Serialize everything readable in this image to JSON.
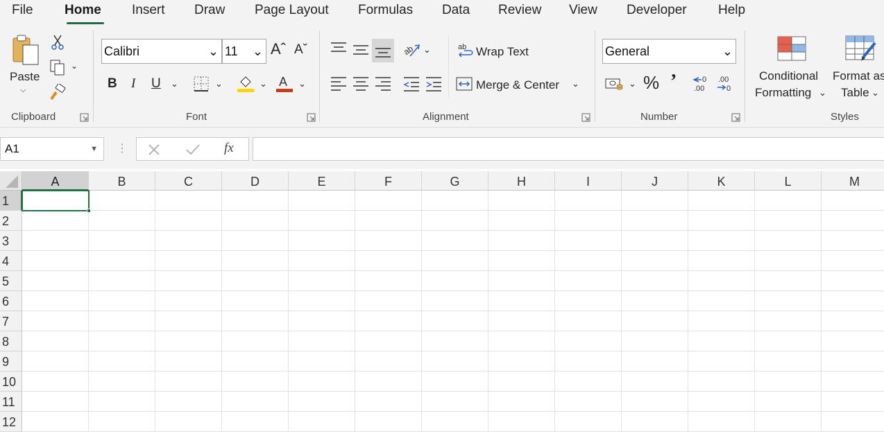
{
  "tabs": {
    "file": "File",
    "home": "Home",
    "insert": "Insert",
    "draw": "Draw",
    "page_layout": "Page Layout",
    "formulas": "Formulas",
    "data": "Data",
    "review": "Review",
    "view": "View",
    "developer": "Developer",
    "help": "Help",
    "active": "Home"
  },
  "ribbon": {
    "clipboard": {
      "label": "Clipboard",
      "paste": "Paste"
    },
    "font": {
      "label": "Font",
      "font_name": "Calibri",
      "font_size": "11",
      "bold": "B",
      "italic": "I",
      "underline": "U"
    },
    "alignment": {
      "label": "Alignment",
      "wrap_text": "Wrap Text",
      "merge_center": "Merge & Center"
    },
    "number": {
      "label": "Number",
      "format": "General",
      "percent": "%"
    },
    "styles": {
      "label": "Styles",
      "conditional_line1": "Conditional",
      "conditional_line2": "Formatting",
      "format_table_line1": "Format as",
      "format_table_line2": "Table"
    }
  },
  "formula_bar": {
    "name_box": "A1",
    "fx": "fx",
    "value": ""
  },
  "grid": {
    "columns": [
      "A",
      "B",
      "C",
      "D",
      "E",
      "F",
      "G",
      "H",
      "I",
      "J",
      "K",
      "L",
      "M"
    ],
    "rows": [
      "1",
      "2",
      "3",
      "4",
      "5",
      "6",
      "7",
      "8",
      "9",
      "10",
      "11",
      "12"
    ],
    "selected_cell": "A1"
  },
  "colors": {
    "accent": "#217346",
    "ribbon_bg": "#f3f3f3",
    "font_color": "#c43e1c",
    "highlight_color": "#ffd700"
  },
  "icons": [
    "paste-icon",
    "cut-icon",
    "copy-icon",
    "format-painter-icon",
    "font-size-increase-icon",
    "font-size-decrease-icon",
    "borders-icon",
    "fill-color-icon",
    "font-color-icon",
    "align-top-icon",
    "align-middle-icon",
    "align-bottom-icon",
    "orientation-icon",
    "wrap-text-icon",
    "align-left-icon",
    "align-center-icon",
    "align-right-icon",
    "decrease-indent-icon",
    "increase-indent-icon",
    "merge-center-icon",
    "accounting-format-icon",
    "comma-style-icon",
    "increase-decimal-icon",
    "decrease-decimal-icon",
    "conditional-formatting-icon",
    "format-as-table-icon"
  ]
}
